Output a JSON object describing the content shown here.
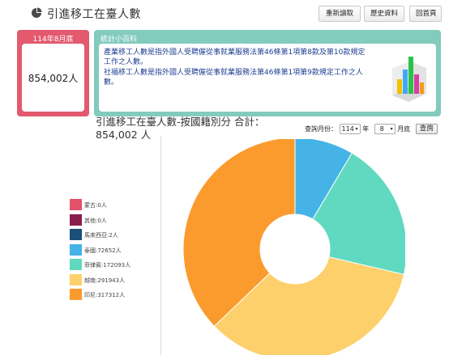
{
  "header": {
    "title": "引進移工在臺人數",
    "buttons": {
      "reload": "重新讀取",
      "history": "歷史資料",
      "home": "回首頁"
    }
  },
  "count_card": {
    "heading": "114年8月底",
    "value": "854,002人"
  },
  "wiki": {
    "heading": "統計小百科",
    "lines": [
      "產業移工人數是指外國人受聘僱從事就業服務法第46條第1項第8款及第10款規定",
      "工作之人數。",
      "社福移工人數是指外國人受聘僱從事就業服務法第46條第1項第9款規定工作之人",
      "數。"
    ]
  },
  "chart_section": {
    "title_line1": "引進移工在臺人數-按國籍別分 合計：",
    "title_line2": "854,002 人",
    "query": {
      "label": "查詢月份：",
      "year": "114",
      "year_unit": "年",
      "month": "8",
      "month_unit": "月底",
      "button": "查詢"
    }
  },
  "legend": [
    {
      "label": "蒙古:0人",
      "color": "#e3526a"
    },
    {
      "label": "其他:0人",
      "color": "#8b1c4e"
    },
    {
      "label": "馬來西亞:2人",
      "color": "#1c4f78"
    },
    {
      "label": "泰國:72652人",
      "color": "#45b3e6"
    },
    {
      "label": "菲律賓:172093人",
      "color": "#60d9c0"
    },
    {
      "label": "越南:291943人",
      "color": "#fdd06c"
    },
    {
      "label": "印尼:317312人",
      "color": "#fb9b2e"
    }
  ],
  "chart_data": {
    "type": "pie",
    "title": "引進移工在臺人數-按國籍別分 合計：854,002 人",
    "categories": [
      "蒙古",
      "其他",
      "馬來西亞",
      "泰國",
      "菲律賓",
      "越南",
      "印尼"
    ],
    "values": [
      0,
      0,
      2,
      72652,
      172093,
      291943,
      317312
    ],
    "colors": [
      "#e3526a",
      "#8b1c4e",
      "#1c4f78",
      "#45b3e6",
      "#60d9c0",
      "#fdd06c",
      "#fb9b2e"
    ],
    "legend": "left",
    "donut": true
  }
}
